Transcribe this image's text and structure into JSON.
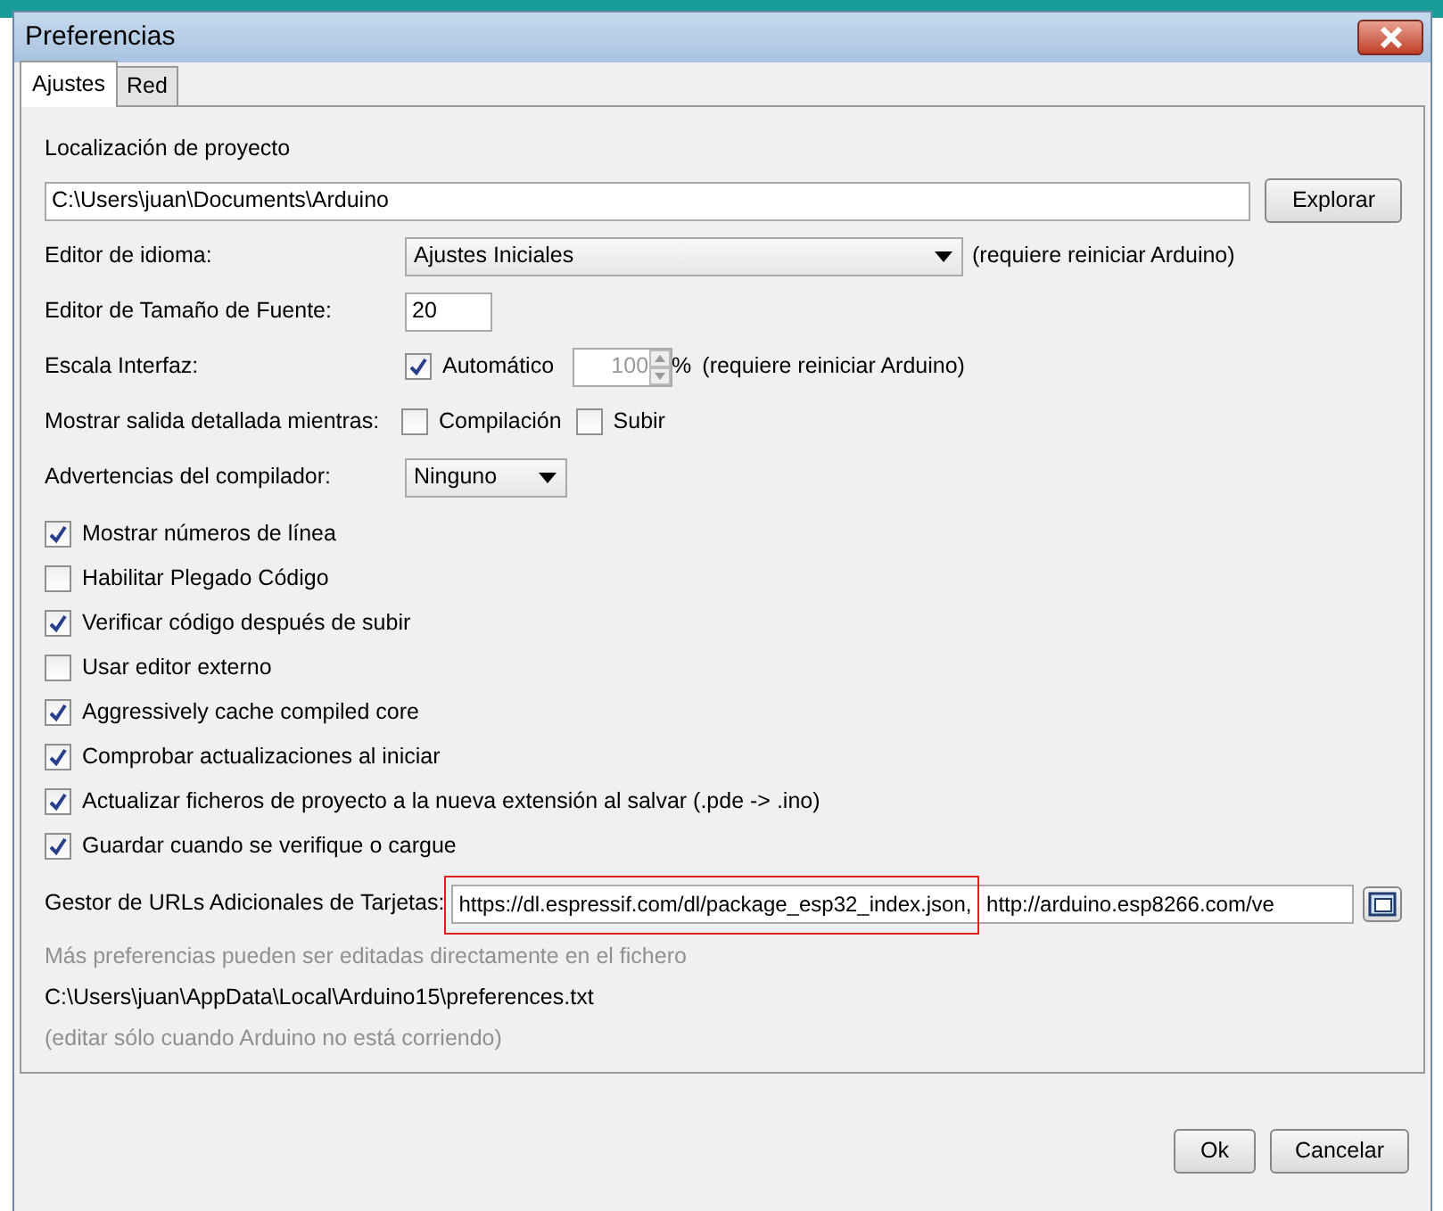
{
  "window": {
    "title": "Preferencias"
  },
  "tabs": [
    {
      "label": "Ajustes",
      "selected": true
    },
    {
      "label": "Red",
      "selected": false
    }
  ],
  "sketchbook": {
    "label": "Localización de proyecto",
    "value": "C:\\Users\\juan\\Documents\\Arduino",
    "button": "Explorar"
  },
  "language": {
    "label": "Editor de idioma:",
    "value": "Ajustes Iniciales",
    "note": "(requiere reiniciar Arduino)"
  },
  "font_size": {
    "label": "Editor de Tamaño de Fuente:",
    "value": "20"
  },
  "scale": {
    "label": "Escala Interfaz:",
    "auto_label": "Automático",
    "auto_checked": true,
    "value": "100",
    "disabled": true,
    "unit": "%",
    "note": "(requiere reiniciar Arduino)"
  },
  "verbose": {
    "label": "Mostrar salida detallada mientras:",
    "options": [
      {
        "label": "Compilación",
        "checked": false
      },
      {
        "label": "Subir",
        "checked": false
      }
    ]
  },
  "warnings": {
    "label": "Advertencias del compilador:",
    "value": "Ninguno"
  },
  "options": [
    {
      "label": "Mostrar números de línea",
      "checked": true
    },
    {
      "label": "Habilitar Plegado Código",
      "checked": false
    },
    {
      "label": "Verificar código después de subir",
      "checked": true
    },
    {
      "label": "Usar editor externo",
      "checked": false
    },
    {
      "label": "Aggressively cache compiled core",
      "checked": true
    },
    {
      "label": "Comprobar actualizaciones al iniciar",
      "checked": true
    },
    {
      "label": "Actualizar ficheros de proyecto a la nueva extensión al salvar (.pde -> .ino)",
      "checked": true
    },
    {
      "label": "Guardar cuando se verifique o cargue",
      "checked": true
    }
  ],
  "board_urls": {
    "label": "Gestor de URLs Adicionales de Tarjetas:",
    "value": "https://dl.espressif.com/dl/package_esp32_index.json, http://arduino.esp8266.com/ve",
    "highlighted": true
  },
  "notes": [
    {
      "text": "Más preferencias pueden ser editadas directamente en el fichero",
      "muted": true
    },
    {
      "text": "C:\\Users\\juan\\AppData\\Local\\Arduino15\\preferences.txt",
      "muted": false
    },
    {
      "text": "(editar sólo cuando Arduino no está corriendo)",
      "muted": true
    }
  ],
  "buttons": [
    "Ok",
    "Cancelar"
  ]
}
